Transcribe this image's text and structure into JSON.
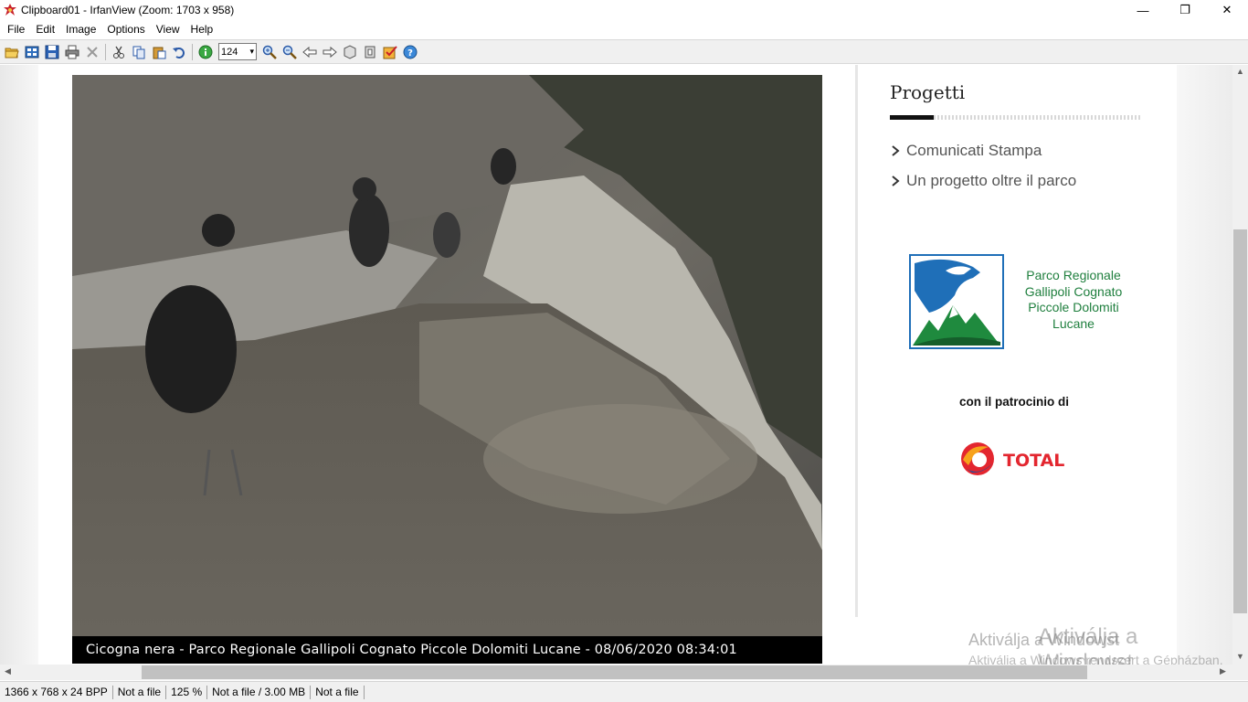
{
  "window": {
    "title": "Clipboard01 - IrfanView (Zoom: 1703 x 958)",
    "minimize": "—",
    "restore": "❐",
    "close": "✕"
  },
  "menu": [
    "File",
    "Edit",
    "Image",
    "Options",
    "View",
    "Help"
  ],
  "toolbar": {
    "zoom_value": "124",
    "icons": [
      "open-icon",
      "thumbnails-icon",
      "save-icon",
      "print-icon",
      "delete-icon",
      "cut-icon",
      "copy-icon",
      "paste-icon",
      "undo-icon",
      "info-icon",
      "zoom-in-icon",
      "zoom-out-icon",
      "previous-icon",
      "next-icon",
      "slideshow-icon",
      "fit-icon",
      "effects-icon",
      "help-icon"
    ]
  },
  "content": {
    "camera_caption": "Cicogna nera - Parco Regionale Gallipoli Cognato Piccole Dolomiti Lucane - 08/06/2020 08:34:01",
    "sidebar_heading": "Progetti",
    "links": [
      "Comunicati Stampa",
      "Un progetto oltre il parco"
    ],
    "park_name": [
      "Parco Regionale",
      "Gallipoli Cognato",
      "Piccole Dolomiti",
      "Lucane"
    ],
    "patronage": "con il patrocinio di",
    "sponsor": "TOTAL",
    "watermark_small": "Aktiválja a Windowst",
    "watermark_large": "Aktiválja a Windowst",
    "watermark_sub": "Aktiválja a Windows rendszert a Gépházban."
  },
  "status": [
    "1366 x 768 x 24 BPP",
    "Not a file",
    "125 %",
    "Not a file / 3.00 MB",
    "Not a file"
  ],
  "colors": {
    "park_green": "#1f7f3e",
    "total_red": "#e3262f",
    "total_blue": "#1d4f9c"
  }
}
